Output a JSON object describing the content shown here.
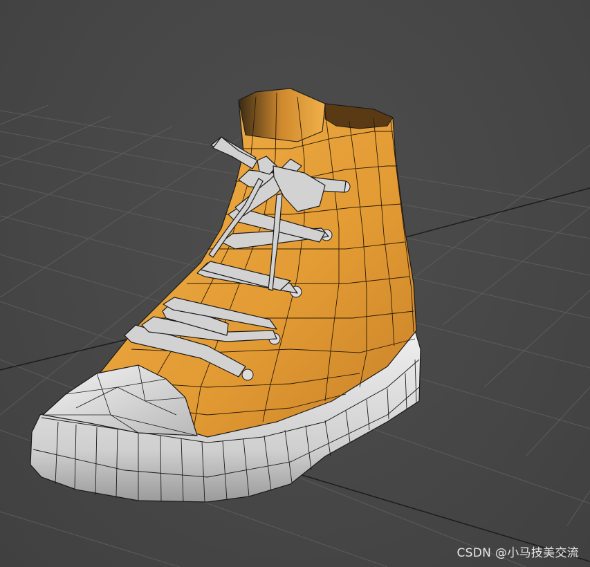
{
  "viewport": {
    "background_color": "#464646",
    "grid_color": "#5a5a5a",
    "grid_dark_color": "#1e1e1e"
  },
  "model": {
    "upper_color": "#e8a23a",
    "upper_shadow_color": "#c27e22",
    "sole_color": "#d9d9d9",
    "lace_color": "#cfcfcf",
    "wire_color": "#1a1a1a"
  },
  "watermark": {
    "text": "CSDN @小马技美交流"
  }
}
